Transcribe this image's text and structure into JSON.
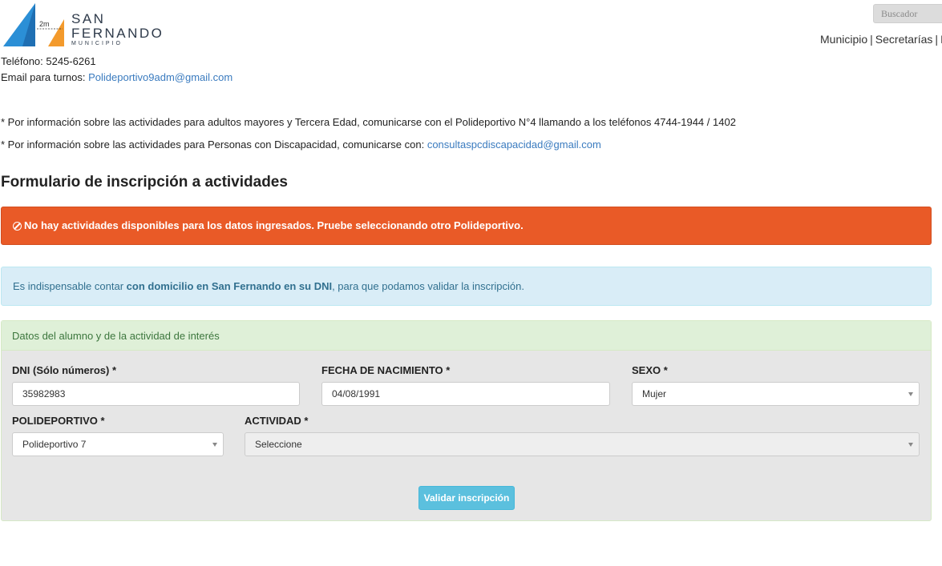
{
  "header": {
    "logo": {
      "line1": "SAN",
      "line2": "FERNANDO",
      "line3": "MUNICIPIO",
      "badge": "2m"
    },
    "search_placeholder": "Buscador",
    "nav": [
      "Municipio",
      "Secretarías",
      "In"
    ],
    "nav_separator": "|"
  },
  "contact": {
    "phone_label_cut": "Teléfono: 5245-6261",
    "email_label": "Email para turnos: ",
    "email": "Polideportivo9adm@gmail.com"
  },
  "notes": {
    "seniors": "* Por información sobre las actividades para adultos mayores y Tercera Edad, comunicarse con el Polideportivo N°4 llamando a los teléfonos 4744-1944 / 1402",
    "disability_prefix": "* Por información sobre las actividades para Personas con Discapacidad, comunicarse con: ",
    "disability_email": "consultaspcdiscapacidad@gmail.com"
  },
  "form": {
    "title": "Formulario de inscripción a actividades",
    "error_message": "No hay actividades disponibles para los datos ingresados. Pruebe seleccionando otro Polideportivo.",
    "info": {
      "prefix": "Es indispensable contar ",
      "bold": "con domicilio en San Fernando en su DNI",
      "suffix": ", para que podamos validar la inscripción."
    },
    "panel_heading": "Datos del alumno y de la actividad de interés",
    "dni": {
      "label": "DNI (Sólo números) *",
      "value": "35982983"
    },
    "birthdate": {
      "label": "FECHA DE NACIMIENTO *",
      "value": "04/08/1991"
    },
    "sex": {
      "label": "SEXO *",
      "value": "Mujer"
    },
    "sport_center": {
      "label": "POLIDEPORTIVO *",
      "value": "Polideportivo 7"
    },
    "activity": {
      "label": "ACTIVIDAD *",
      "value": "Seleccione"
    },
    "submit_label": "Validar inscripción"
  },
  "colors": {
    "danger": "#e95a27",
    "info_bg": "#d9edf7",
    "success_bg": "#dff0d8",
    "button": "#5bc0de",
    "link": "#3a7bbf"
  }
}
